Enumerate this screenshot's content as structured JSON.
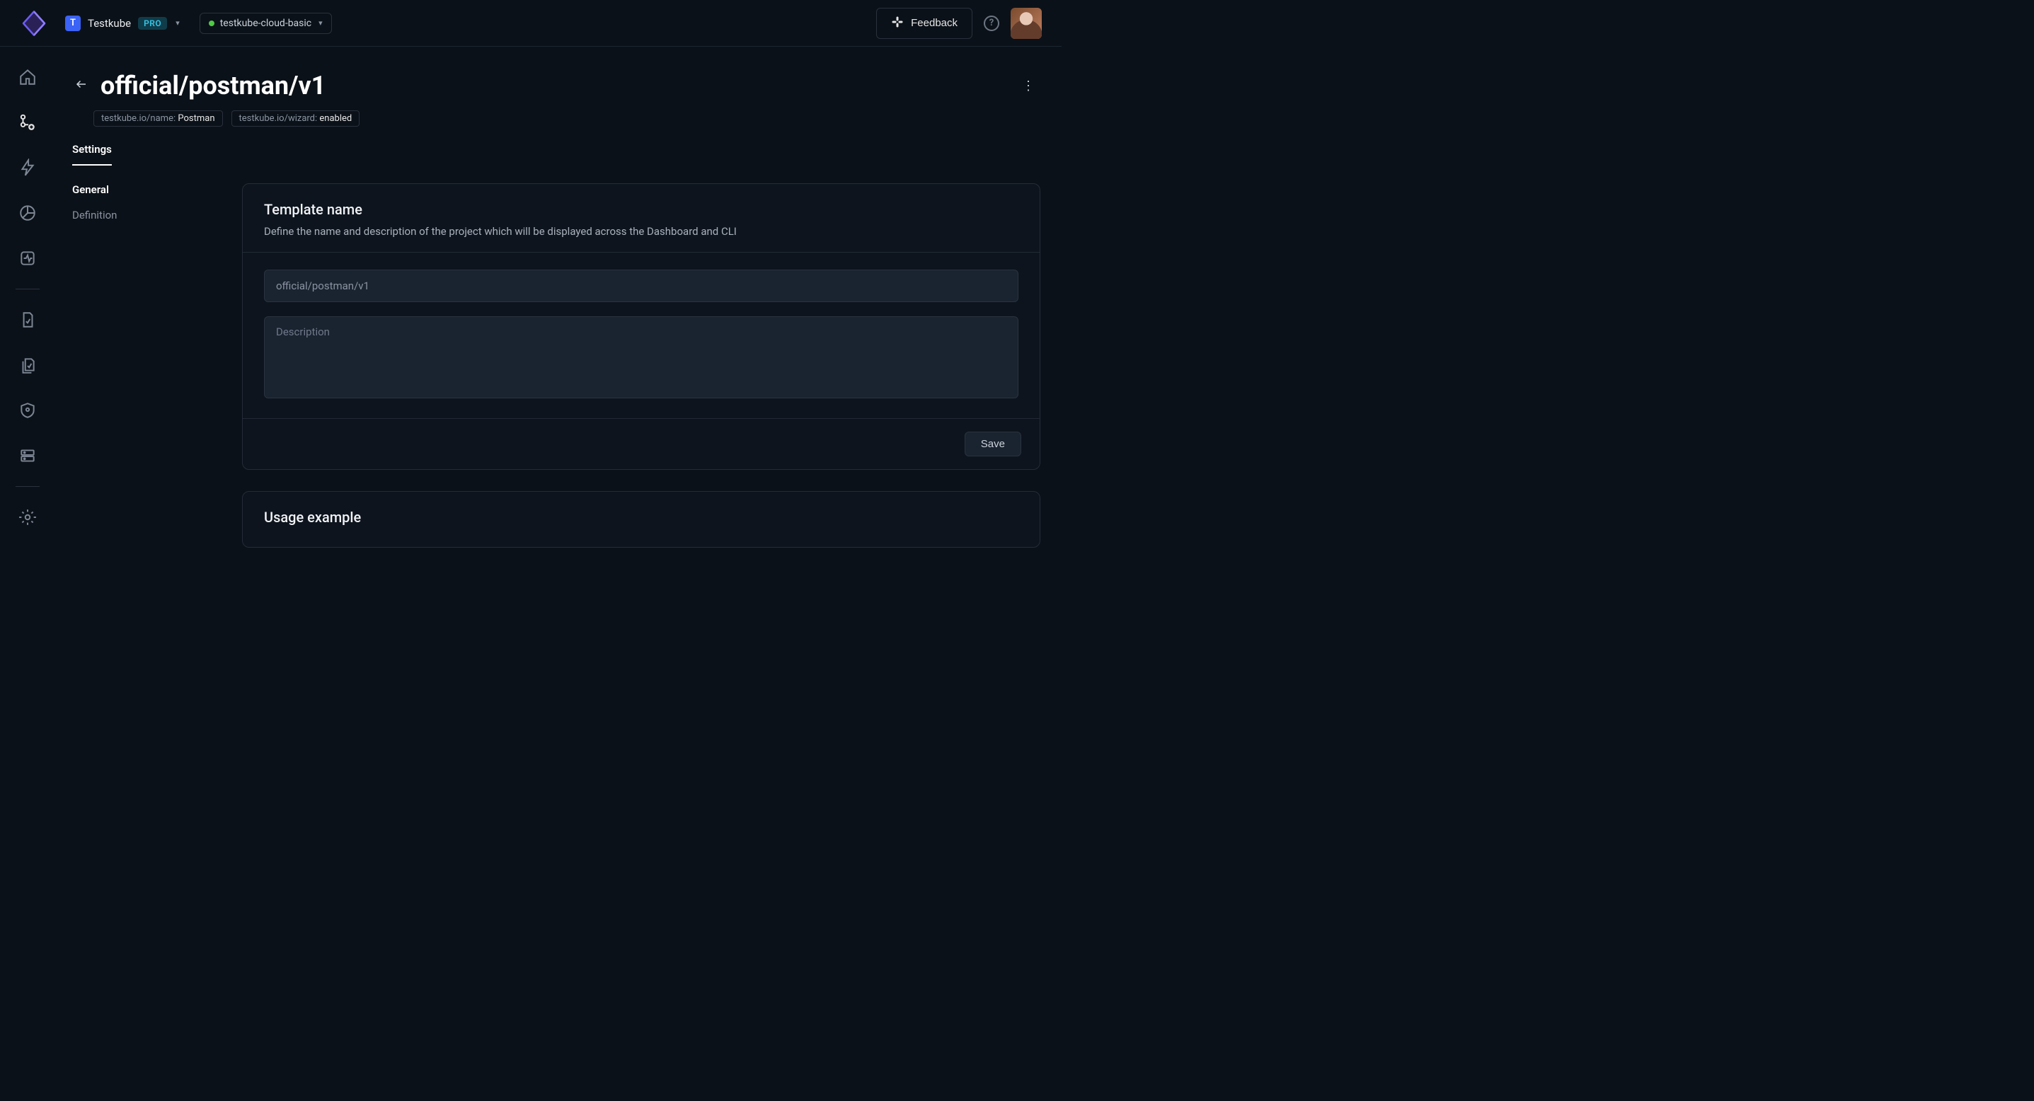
{
  "header": {
    "org_initial": "T",
    "org_name": "Testkube",
    "plan_badge": "PRO",
    "environment": "testkube-cloud-basic",
    "feedback_label": "Feedback"
  },
  "page": {
    "title": "official/postman/v1",
    "labels": [
      {
        "key": "testkube.io/name:",
        "value": "Postman"
      },
      {
        "key": "testkube.io/wizard:",
        "value": "enabled"
      }
    ],
    "tab": "Settings"
  },
  "settings_nav": {
    "general": "General",
    "definition": "Definition"
  },
  "template_card": {
    "title": "Template name",
    "subtitle": "Define the name and description of the project which will be displayed across the Dashboard and CLI",
    "name_value": "official/postman/v1",
    "description_placeholder": "Description",
    "save_label": "Save"
  },
  "usage_card": {
    "title": "Usage example"
  }
}
